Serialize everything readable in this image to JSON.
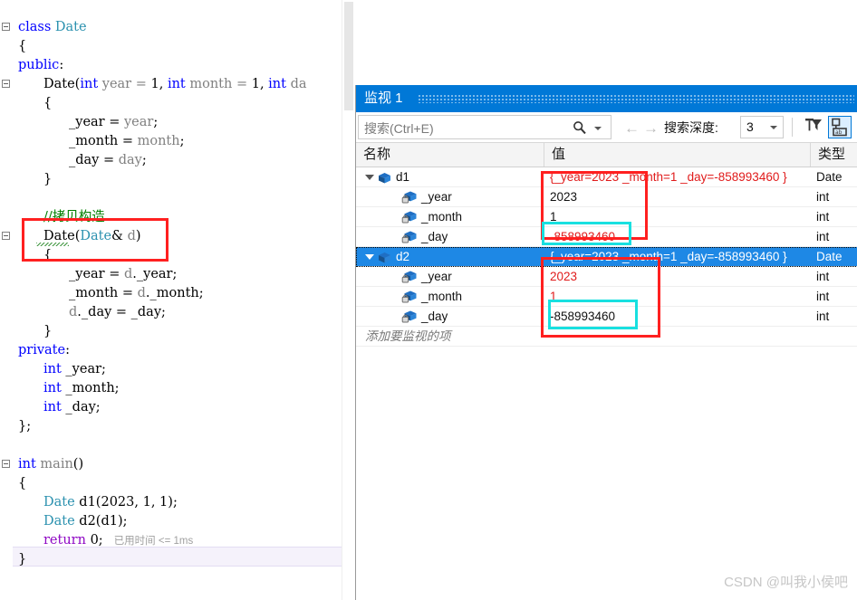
{
  "editor": {
    "lines": [
      {
        "indent": 0,
        "fold": true,
        "tokens": [
          {
            "t": "class ",
            "c": "kw"
          },
          {
            "t": "Date",
            "c": "cls"
          }
        ]
      },
      {
        "indent": 0,
        "tokens": [
          {
            "t": "{",
            "c": "plain"
          }
        ]
      },
      {
        "indent": 0,
        "tokens": [
          {
            "t": "public",
            "c": "kw"
          },
          {
            "t": ":",
            "c": "plain"
          }
        ]
      },
      {
        "indent": 1,
        "fold": true,
        "tokens": [
          {
            "t": "Date(",
            "c": "plain"
          },
          {
            "t": "int",
            "c": "kw"
          },
          {
            "t": " year = ",
            "c": "id"
          },
          {
            "t": "1",
            "c": "num"
          },
          {
            "t": ", ",
            "c": "plain"
          },
          {
            "t": "int",
            "c": "kw"
          },
          {
            "t": " month = ",
            "c": "id"
          },
          {
            "t": "1",
            "c": "num"
          },
          {
            "t": ", ",
            "c": "plain"
          },
          {
            "t": "int",
            "c": "kw"
          },
          {
            "t": " da",
            "c": "id"
          }
        ]
      },
      {
        "indent": 1,
        "tokens": [
          {
            "t": "{",
            "c": "plain"
          }
        ]
      },
      {
        "indent": 2,
        "tokens": [
          {
            "t": "_year = ",
            "c": "plain"
          },
          {
            "t": "year",
            "c": "id"
          },
          {
            "t": ";",
            "c": "plain"
          }
        ]
      },
      {
        "indent": 2,
        "tokens": [
          {
            "t": "_month = ",
            "c": "plain"
          },
          {
            "t": "month",
            "c": "id"
          },
          {
            "t": ";",
            "c": "plain"
          }
        ]
      },
      {
        "indent": 2,
        "tokens": [
          {
            "t": "_day = ",
            "c": "plain"
          },
          {
            "t": "day",
            "c": "id"
          },
          {
            "t": ";",
            "c": "plain"
          }
        ]
      },
      {
        "indent": 1,
        "tokens": [
          {
            "t": "}",
            "c": "plain"
          }
        ]
      },
      {
        "indent": 0,
        "tokens": []
      },
      {
        "indent": 1,
        "tokens": [
          {
            "t": "//拷贝构造",
            "c": "cmt"
          }
        ]
      },
      {
        "indent": 1,
        "fold": true,
        "tokens": [
          {
            "t": "Date",
            "c": "plain"
          },
          {
            "t": "(",
            "c": "plain"
          },
          {
            "t": "Date",
            "c": "cls"
          },
          {
            "t": "& ",
            "c": "plain"
          },
          {
            "t": "d",
            "c": "id"
          },
          {
            "t": ")",
            "c": "plain"
          }
        ]
      },
      {
        "indent": 1,
        "tokens": [
          {
            "t": "{",
            "c": "plain"
          }
        ]
      },
      {
        "indent": 2,
        "tokens": [
          {
            "t": "_year = ",
            "c": "plain"
          },
          {
            "t": "d",
            "c": "id"
          },
          {
            "t": ".",
            "c": "plain"
          },
          {
            "t": "_year",
            "c": "plain"
          },
          {
            "t": ";",
            "c": "plain"
          }
        ]
      },
      {
        "indent": 2,
        "tokens": [
          {
            "t": "_month = ",
            "c": "plain"
          },
          {
            "t": "d",
            "c": "id"
          },
          {
            "t": ".",
            "c": "plain"
          },
          {
            "t": "_month",
            "c": "plain"
          },
          {
            "t": ";",
            "c": "plain"
          }
        ]
      },
      {
        "indent": 2,
        "tokens": [
          {
            "t": "d",
            "c": "id"
          },
          {
            "t": "._day = _day;",
            "c": "plain"
          }
        ]
      },
      {
        "indent": 1,
        "tokens": [
          {
            "t": "}",
            "c": "plain"
          }
        ]
      },
      {
        "indent": 0,
        "tokens": [
          {
            "t": "private",
            "c": "kw"
          },
          {
            "t": ":",
            "c": "plain"
          }
        ]
      },
      {
        "indent": 1,
        "tokens": [
          {
            "t": "int",
            "c": "kw"
          },
          {
            "t": " _year;",
            "c": "plain"
          }
        ]
      },
      {
        "indent": 1,
        "tokens": [
          {
            "t": "int",
            "c": "kw"
          },
          {
            "t": " _month;",
            "c": "plain"
          }
        ]
      },
      {
        "indent": 1,
        "tokens": [
          {
            "t": "int",
            "c": "kw"
          },
          {
            "t": " _day;",
            "c": "plain"
          }
        ]
      },
      {
        "indent": 0,
        "tokens": [
          {
            "t": "};",
            "c": "plain"
          }
        ]
      },
      {
        "indent": 0,
        "tokens": []
      },
      {
        "indent": 0,
        "fold": true,
        "tokens": [
          {
            "t": "int",
            "c": "kw"
          },
          {
            "t": " ",
            "c": "plain"
          },
          {
            "t": "main",
            "c": "id"
          },
          {
            "t": "()",
            "c": "plain"
          }
        ]
      },
      {
        "indent": 0,
        "tokens": [
          {
            "t": "{",
            "c": "plain"
          }
        ]
      },
      {
        "indent": 1,
        "tokens": [
          {
            "t": "Date",
            "c": "cls"
          },
          {
            "t": " d1(",
            "c": "plain"
          },
          {
            "t": "2023",
            "c": "num"
          },
          {
            "t": ", ",
            "c": "plain"
          },
          {
            "t": "1",
            "c": "num"
          },
          {
            "t": ", ",
            "c": "plain"
          },
          {
            "t": "1",
            "c": "num"
          },
          {
            "t": ");",
            "c": "plain"
          }
        ]
      },
      {
        "indent": 1,
        "tokens": [
          {
            "t": "Date",
            "c": "cls"
          },
          {
            "t": " d2(d1);",
            "c": "plain"
          }
        ]
      },
      {
        "indent": 1,
        "current": true,
        "tokens": [
          {
            "t": "return",
            "c": "ctrl"
          },
          {
            "t": " ",
            "c": "plain"
          },
          {
            "t": "0",
            "c": "num"
          },
          {
            "t": ";",
            "c": "plain"
          }
        ]
      },
      {
        "indent": 0,
        "tokens": [
          {
            "t": "}",
            "c": "plain"
          }
        ]
      }
    ],
    "elapsed_label": "已用时间 <= 1ms"
  },
  "watch": {
    "title": "监视 1",
    "search": {
      "placeholder": "搜索(Ctrl+E)",
      "icon": "search-icon"
    },
    "nav": {
      "back_icon": "←",
      "forward_icon": "→"
    },
    "depth": {
      "label": "搜索深度:",
      "value": "3"
    },
    "toolbar_buttons": [
      {
        "name": "pin-filter-icon",
        "label": ""
      },
      {
        "name": "hex-display-icon",
        "label": "",
        "active": true
      }
    ],
    "columns": [
      "名称",
      "值",
      "类型"
    ],
    "rows": [
      {
        "name": "d1",
        "indent": 0,
        "icon": "object-cube-icon",
        "expander": "open",
        "value": "{_year=2023 _month=1 _day=-858993460 }",
        "value_color": "red",
        "type": "Date",
        "selected": false
      },
      {
        "name": "_year",
        "indent": 1,
        "icon": "private-field-icon",
        "value": "2023",
        "value_color": "black",
        "type": "int",
        "selected": false
      },
      {
        "name": "_month",
        "indent": 1,
        "icon": "private-field-icon",
        "value": "1",
        "value_color": "black",
        "type": "int",
        "selected": false
      },
      {
        "name": "_day",
        "indent": 1,
        "icon": "private-field-icon",
        "value": "-858993460",
        "value_color": "red",
        "type": "int",
        "selected": false
      },
      {
        "name": "d2",
        "indent": 0,
        "icon": "object-cube-icon",
        "expander": "open",
        "value": "{_year=2023 _month=1 _day=-858993460 }",
        "value_color": "white",
        "type": "Date",
        "selected": true
      },
      {
        "name": "_year",
        "indent": 1,
        "icon": "private-field-icon",
        "value": "2023",
        "value_color": "red",
        "type": "int",
        "selected": false
      },
      {
        "name": "_month",
        "indent": 1,
        "icon": "private-field-icon",
        "value": "1",
        "value_color": "red",
        "type": "int",
        "selected": false
      },
      {
        "name": "_day",
        "indent": 1,
        "icon": "private-field-icon",
        "value": "-858993460",
        "value_color": "black",
        "type": "int",
        "selected": false
      }
    ],
    "add_row_placeholder": "添加要监视的项"
  },
  "watermark": "CSDN @叫我小侯吧",
  "colors": {
    "accent": "#0078d7",
    "selection": "#1e88e5",
    "annotation_red": "#ff2020",
    "annotation_cyan": "#18e0e0",
    "changed_value": "#e01b1b"
  }
}
